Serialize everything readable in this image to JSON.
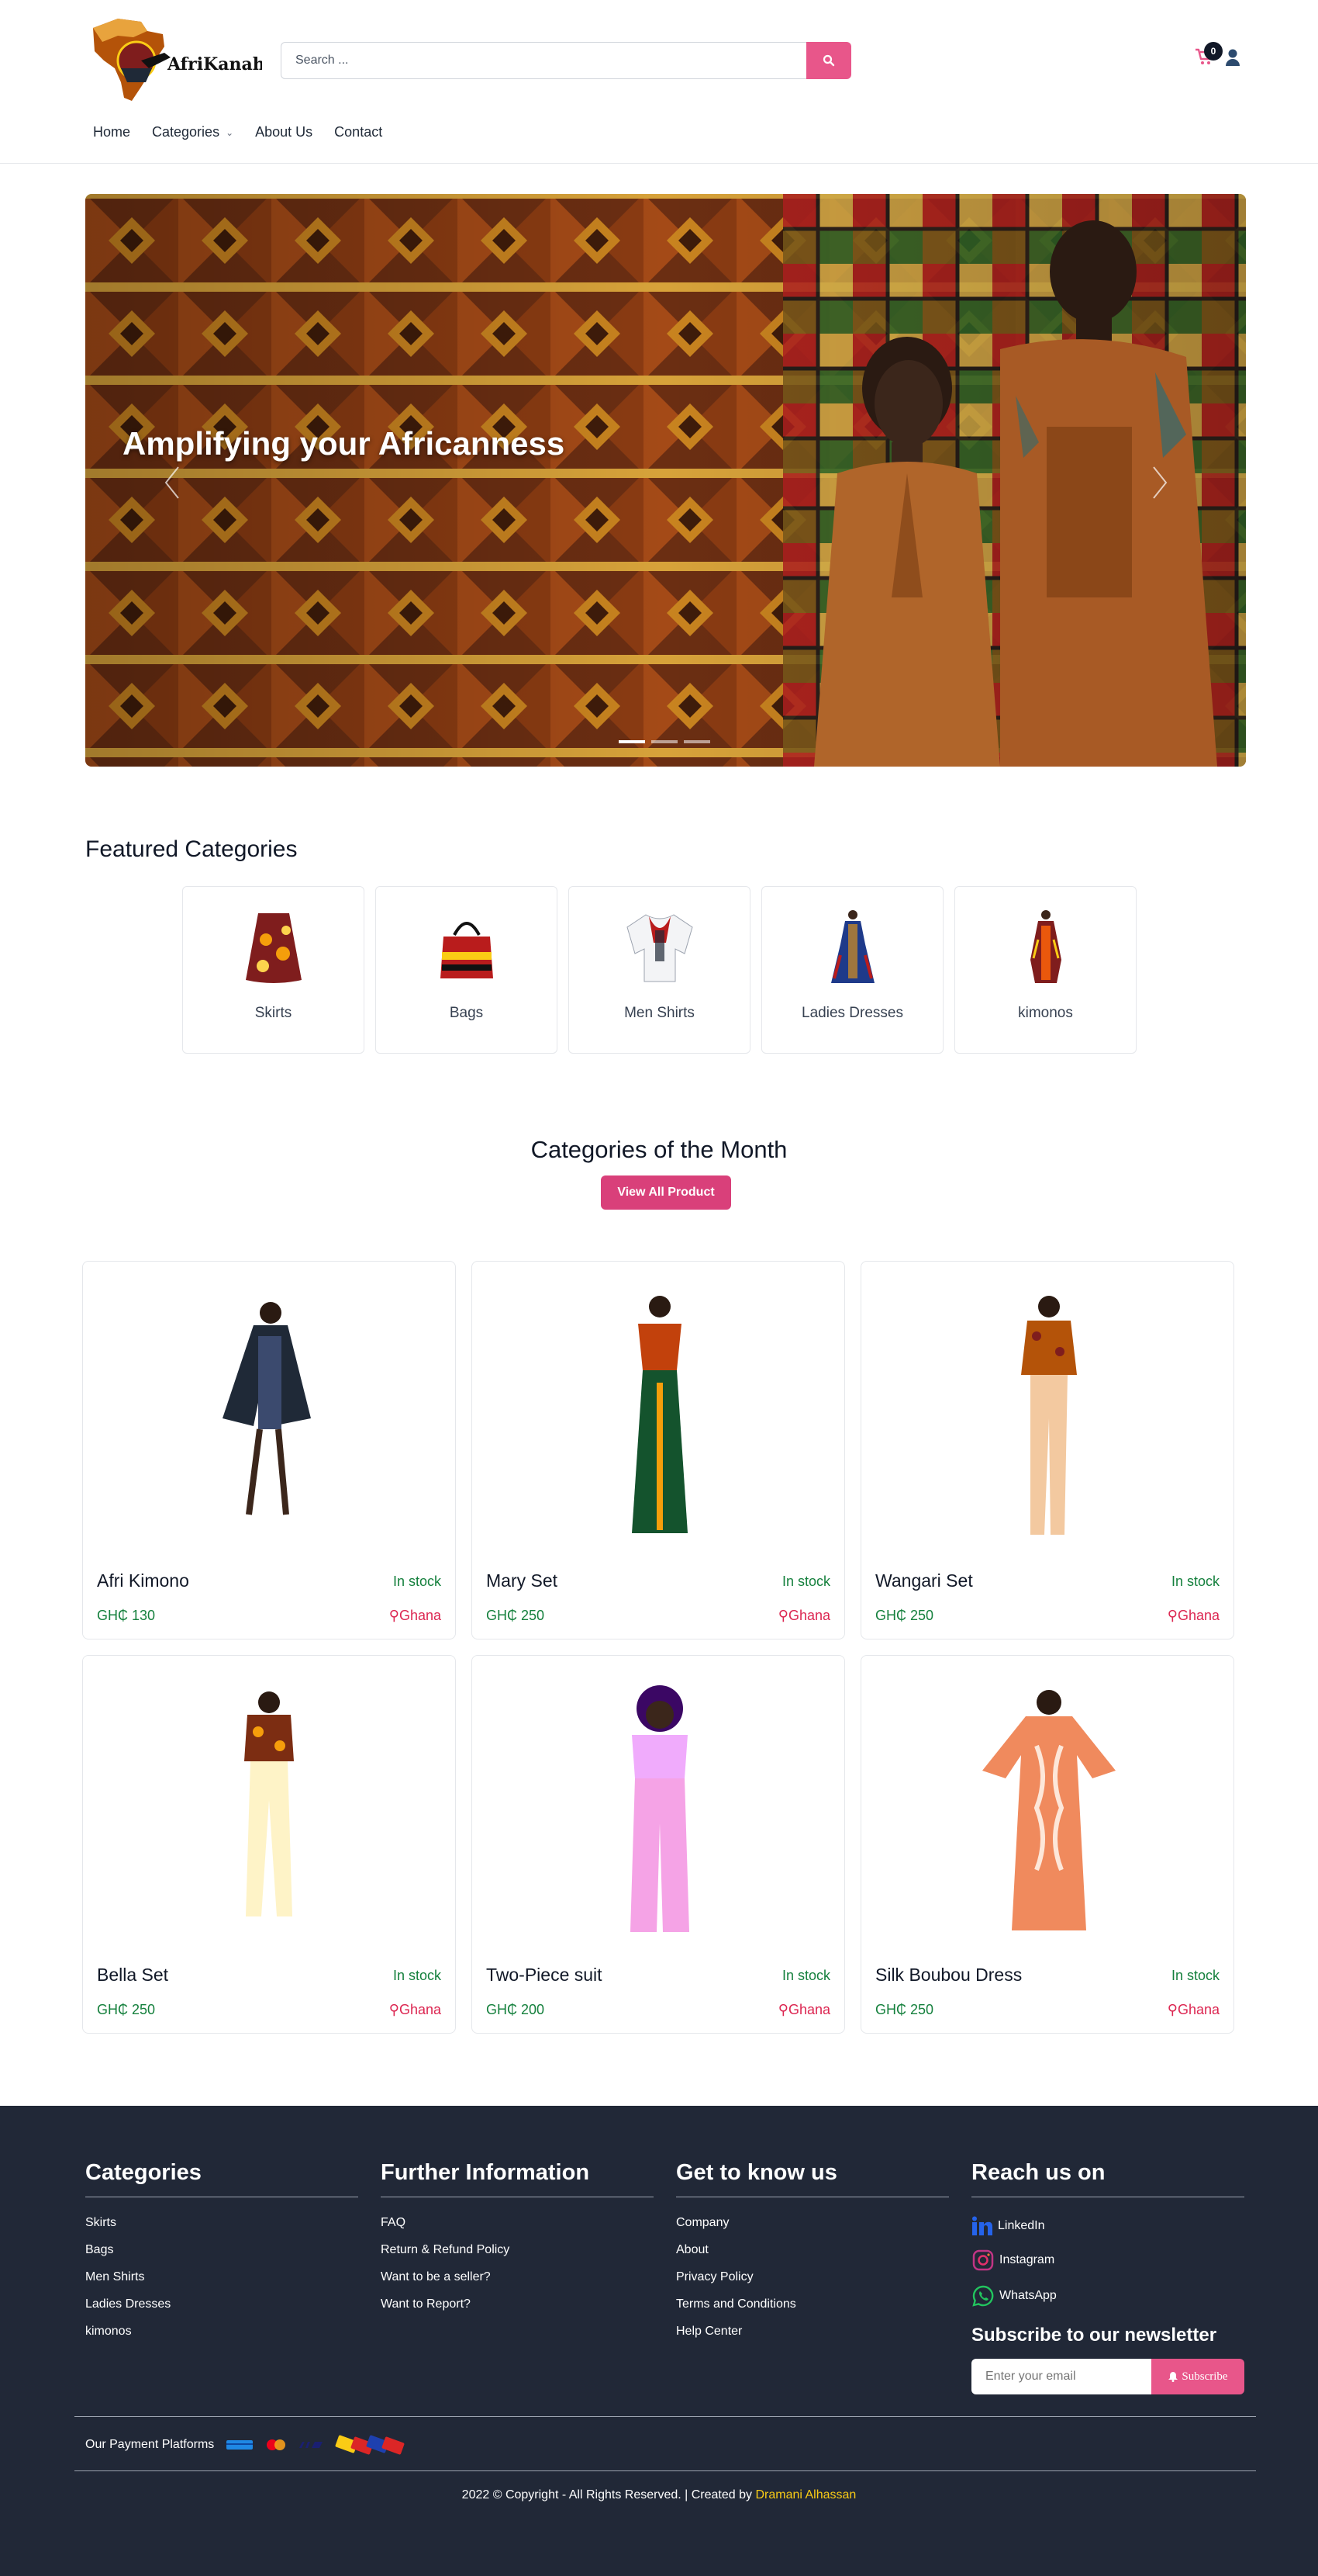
{
  "brand": {
    "logo_text": "AfriKanah"
  },
  "search": {
    "placeholder": "Search ..."
  },
  "cart": {
    "count": "0"
  },
  "nav": [
    {
      "label": "Home"
    },
    {
      "label": "Categories"
    },
    {
      "label": "About Us"
    },
    {
      "label": "Contact"
    }
  ],
  "hero": {
    "title": "Amplifying your Africanness"
  },
  "featured": {
    "title": "Featured Categories",
    "items": [
      {
        "label": "Skirts",
        "icon": "skirt-icon"
      },
      {
        "label": "Bags",
        "icon": "bag-icon"
      },
      {
        "label": "Men Shirts",
        "icon": "shirt-icon"
      },
      {
        "label": "Ladies Dresses",
        "icon": "dress-icon"
      },
      {
        "label": "kimonos",
        "icon": "kimono-icon"
      }
    ]
  },
  "month": {
    "title": "Categories of the Month",
    "button": "View All Product"
  },
  "products": [
    {
      "name": "Afri Kimono",
      "stock": "In stock",
      "price": "GH₵ 130",
      "location": "Ghana"
    },
    {
      "name": "Mary Set",
      "stock": "In stock",
      "price": "GH₵ 250",
      "location": "Ghana"
    },
    {
      "name": "Wangari Set",
      "stock": "In stock",
      "price": "GH₵ 250",
      "location": "Ghana"
    },
    {
      "name": "Bella Set",
      "stock": "In stock",
      "price": "GH₵ 250",
      "location": "Ghana"
    },
    {
      "name": "Two-Piece suit",
      "stock": "In stock",
      "price": "GH₵ 200",
      "location": "Ghana"
    },
    {
      "name": "Silk Boubou Dress",
      "stock": "In stock",
      "price": "GH₵ 250",
      "location": "Ghana"
    }
  ],
  "footer": {
    "categories": {
      "title": "Categories",
      "links": [
        "Skirts",
        "Bags",
        "Men Shirts",
        "Ladies Dresses",
        "kimonos"
      ]
    },
    "info": {
      "title": "Further Information",
      "links": [
        "FAQ",
        "Return & Refund Policy",
        "Want to be a seller?",
        "Want to Report?"
      ]
    },
    "know": {
      "title": "Get to know us",
      "links": [
        "Company",
        "About",
        "Privacy Policy",
        "Terms and Conditions",
        "Help Center"
      ]
    },
    "reach": {
      "title": "Reach us on",
      "links": [
        "LinkedIn",
        "Instagram",
        "WhatsApp"
      ]
    },
    "newsletter": {
      "title": "Subscribe to our newsletter",
      "placeholder": "Enter your email",
      "button": "Subscribe"
    },
    "payment_label": "Our Payment Platforms",
    "copyright": "2022 © Copyright - All Rights Reserved. | Created by ",
    "author": "Dramani Alhassan"
  },
  "colors": {
    "accent": "#e8568a",
    "stock": "#15803d",
    "location": "#dc2651",
    "footer_bg": "#212837",
    "author": "#facc15"
  }
}
